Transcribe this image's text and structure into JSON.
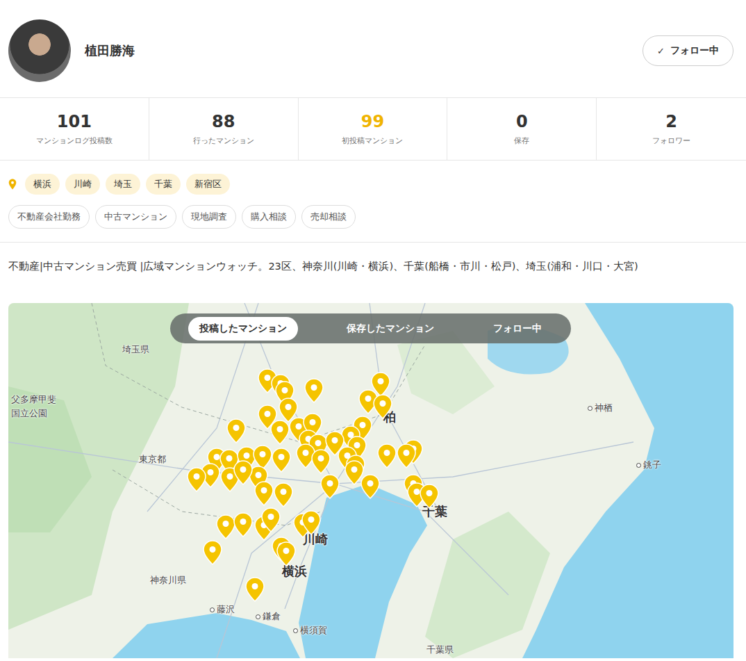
{
  "user": {
    "name": "植田勝海",
    "follow_button": {
      "icon": "✓",
      "label": "フォロー中"
    }
  },
  "stats": [
    {
      "value": "101",
      "label": "マンションログ投稿数",
      "color": "#333333"
    },
    {
      "value": "88",
      "label": "行ったマンション",
      "color": "#333333"
    },
    {
      "value": "99",
      "label": "初投稿マンション",
      "color": "#f0b400"
    },
    {
      "value": "0",
      "label": "保存",
      "color": "#333333"
    },
    {
      "value": "2",
      "label": "フォロワー",
      "color": "#333333"
    }
  ],
  "areas": [
    "横浜",
    "川崎",
    "埼玉",
    "千葉",
    "新宿区"
  ],
  "tags": [
    "不動産会社勤務",
    "中古マンション",
    "現地調査",
    "購入相談",
    "売却相談"
  ],
  "bio": "不動産|中古マンション売買 |広域マンションウォッチ。23区、神奈川(川崎・横浜)、千葉(船橋・市川・松戸)、埼玉(浦和・川口・大宮)",
  "map": {
    "tabs": [
      {
        "label": "投稿したマンション",
        "selected": true
      },
      {
        "label": "保存したマンション",
        "selected": false
      },
      {
        "label": "フォロー中",
        "selected": false
      }
    ],
    "labels": [
      {
        "text": "埼玉県",
        "kind": "region"
      },
      {
        "text": "父多摩甲斐",
        "kind": "region"
      },
      {
        "text": "国立公園",
        "kind": "region"
      },
      {
        "text": "東京都",
        "kind": "region"
      },
      {
        "text": "神奈川県",
        "kind": "region"
      },
      {
        "text": "柏",
        "kind": "major"
      },
      {
        "text": "神栖",
        "kind": "city"
      },
      {
        "text": "銚子",
        "kind": "city"
      },
      {
        "text": "千葉",
        "kind": "major"
      },
      {
        "text": "川崎",
        "kind": "major"
      },
      {
        "text": "横浜",
        "kind": "major"
      },
      {
        "text": "藤沢",
        "kind": "city"
      },
      {
        "text": "鎌倉",
        "kind": "city"
      },
      {
        "text": "横須賀",
        "kind": "city"
      },
      {
        "text": "千葉県",
        "kind": "region"
      }
    ]
  }
}
